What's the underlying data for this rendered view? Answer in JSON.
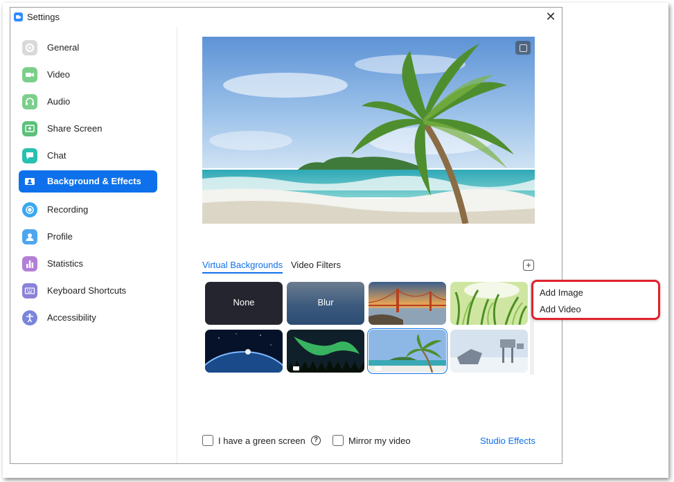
{
  "window": {
    "title": "Settings",
    "close_glyph": "✕"
  },
  "sidebar": {
    "items": [
      {
        "label": "General",
        "icon": "gear-icon",
        "color": "#d9d9d9"
      },
      {
        "label": "Video",
        "icon": "video-camera-icon",
        "color": "#7bcf8a"
      },
      {
        "label": "Audio",
        "icon": "headphones-icon",
        "color": "#7bcf8a"
      },
      {
        "label": "Share Screen",
        "icon": "share-screen-icon",
        "color": "#5bc17a"
      },
      {
        "label": "Chat",
        "icon": "chat-bubble-icon",
        "color": "#28c0b0"
      },
      {
        "label": "Background & Effects",
        "icon": "person-card-icon",
        "color": "#0e71eb",
        "active": true
      },
      {
        "label": "Recording",
        "icon": "record-icon",
        "color": "#38a8f0"
      },
      {
        "label": "Profile",
        "icon": "profile-icon",
        "color": "#4ea6ef"
      },
      {
        "label": "Statistics",
        "icon": "bar-chart-icon",
        "color": "#b27fd6"
      },
      {
        "label": "Keyboard Shortcuts",
        "icon": "keyboard-icon",
        "color": "#8a82d8"
      },
      {
        "label": "Accessibility",
        "icon": "accessibility-icon",
        "color": "#7a86dc"
      }
    ]
  },
  "main": {
    "tabs": [
      {
        "label": "Virtual Backgrounds",
        "active": true
      },
      {
        "label": "Video Filters",
        "active": false
      }
    ],
    "add_glyph": "+",
    "thumbnails": [
      {
        "label": "None",
        "kind": "solid"
      },
      {
        "label": "Blur",
        "kind": "blur"
      },
      {
        "label": "",
        "kind": "golden-gate"
      },
      {
        "label": "",
        "kind": "grass"
      },
      {
        "label": "",
        "kind": "earth"
      },
      {
        "label": "",
        "kind": "aurora",
        "video": true
      },
      {
        "label": "",
        "kind": "beach",
        "video": true,
        "selected": true
      },
      {
        "label": "",
        "kind": "walkers"
      }
    ],
    "dropdown": [
      "Add Image",
      "Add Video"
    ],
    "green_screen_label": "I have a green screen",
    "help_glyph": "?",
    "mirror_label": "Mirror my video",
    "studio_effects": "Studio Effects"
  }
}
